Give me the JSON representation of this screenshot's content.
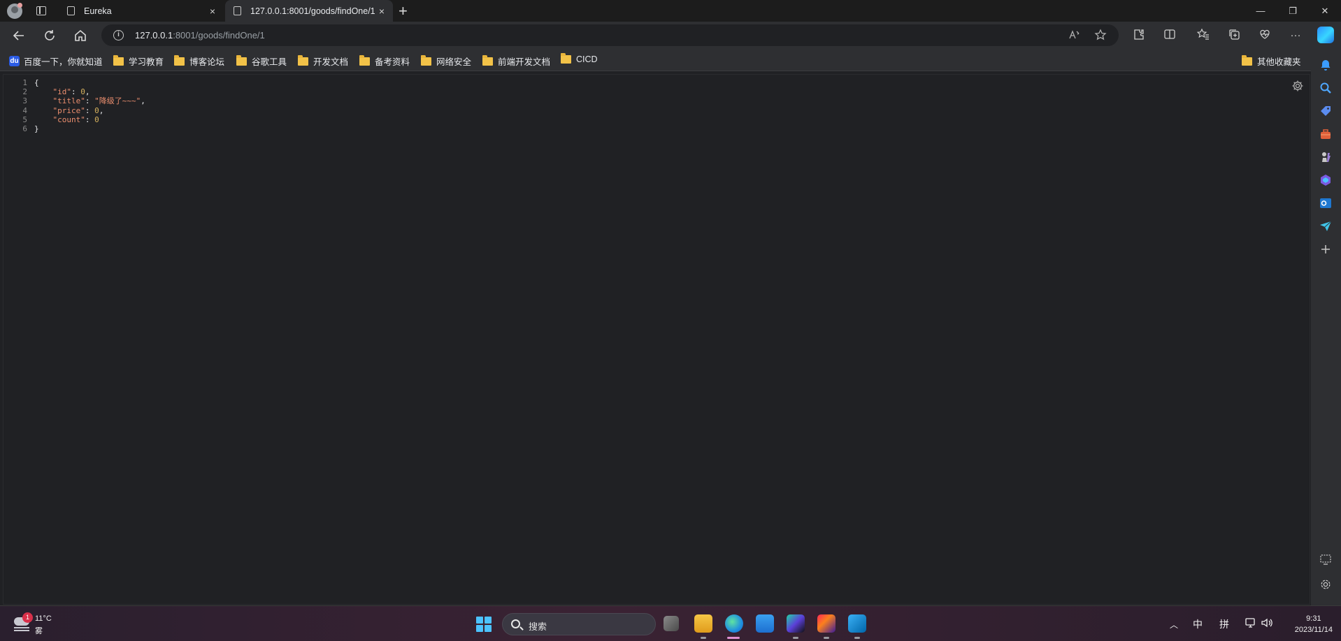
{
  "browser": {
    "tabs": [
      {
        "label": "Eureka",
        "active": false
      },
      {
        "label": "127.0.0.1:8001/goods/findOne/1",
        "active": true
      }
    ],
    "tab_close_glyph": "×",
    "new_tab_glyph": "+",
    "address": {
      "host": "127.0.0.1",
      "path": ":8001/goods/findOne/1"
    },
    "window_controls": {
      "minimize": "—",
      "restore": "❐",
      "close": "✕"
    }
  },
  "bookmarks": [
    {
      "label": "百度一下，你就知道",
      "icon": "baidu-icon"
    },
    {
      "label": "学习教育",
      "icon": "folder-icon"
    },
    {
      "label": "博客论坛",
      "icon": "folder-icon"
    },
    {
      "label": "谷歌工具",
      "icon": "folder-icon"
    },
    {
      "label": "开发文档",
      "icon": "folder-icon"
    },
    {
      "label": "备考资料",
      "icon": "folder-icon"
    },
    {
      "label": "网络安全",
      "icon": "folder-icon"
    },
    {
      "label": "前端开发文档",
      "icon": "folder-icon"
    },
    {
      "label": "CICD",
      "icon": "folder-icon"
    }
  ],
  "other_bookmarks": "其他收藏夹",
  "json_viewer": {
    "line_numbers": [
      "1",
      "2",
      "3",
      "4",
      "5",
      "6"
    ],
    "open_brace": "{",
    "close_brace": "}",
    "fields": [
      {
        "key": "\"id\"",
        "value": "0",
        "type": "number",
        "comma": ","
      },
      {
        "key": "\"title\"",
        "value": "\"降级了~~~\"",
        "type": "string",
        "comma": ","
      },
      {
        "key": "\"price\"",
        "value": "0",
        "type": "number",
        "comma": ","
      },
      {
        "key": "\"count\"",
        "value": "0",
        "type": "number",
        "comma": ""
      }
    ]
  },
  "taskbar": {
    "weather": {
      "temp": "11°C",
      "desc": "雾",
      "badge": "1"
    },
    "search_placeholder": "搜索",
    "ime_lang": "中",
    "ime_mode": "拼",
    "time": "9:31",
    "date": "2023/11/14"
  },
  "colors": {
    "json_key": "#eb8e6e",
    "json_number": "#d6b25e",
    "accent": "#4cc2ff"
  }
}
